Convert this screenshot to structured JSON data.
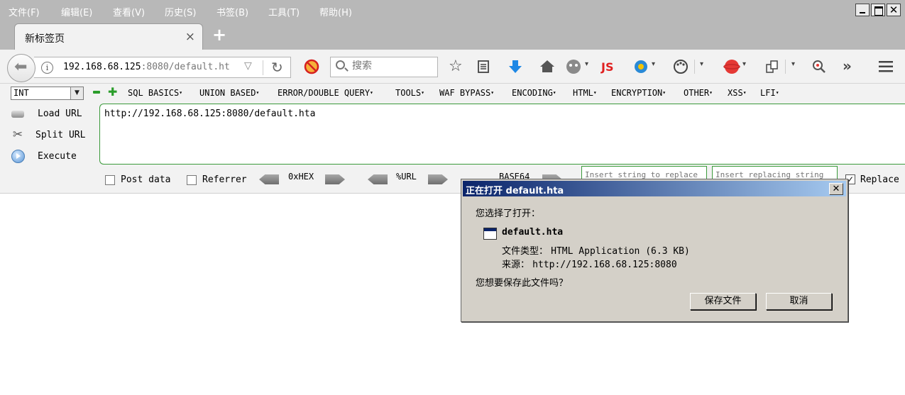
{
  "menubar": {
    "items": [
      "文件(F)",
      "编辑(E)",
      "查看(V)",
      "历史(S)",
      "书签(B)",
      "工具(T)",
      "帮助(H)"
    ]
  },
  "tabs": {
    "active_title": "新标签页",
    "close_glyph": "×",
    "new_tab_glyph": "+"
  },
  "navbar": {
    "url_host": "192.168.68.125",
    "url_rest": ":8080/default.ht",
    "search_placeholder": "搜索",
    "js_label": "JS"
  },
  "hackbar": {
    "int_value": "INT",
    "menus": [
      "SQL BASICS",
      "UNION BASED",
      "ERROR/DOUBLE QUERY",
      "TOOLS",
      "WAF BYPASS",
      "ENCODING",
      "HTML",
      "ENCRYPTION",
      "OTHER",
      "XSS",
      "LFI"
    ],
    "load_url": "Load URL",
    "split_url": "Split URL",
    "execute": "Execute",
    "url_value": "http://192.168.68.125:8080/default.hta",
    "post_data": "Post data",
    "referrer": "Referrer",
    "hex_label": "0xHEX",
    "url_label": "%URL",
    "base64_label": "BASE64",
    "insert_string_placeholder": "Insert string to replace",
    "insert_replacing_placeholder": "Insert replacing string",
    "replace_label": "Replace",
    "replace_checked": "✓"
  },
  "dialog": {
    "title": "正在打开 default.hta",
    "close_glyph": "✕",
    "chosen_text": "您选择了打开：",
    "file_name": "default.hta",
    "file_type_label": "文件类型：",
    "file_type_value": "HTML Application (6.3 KB)",
    "source_label": "来源：",
    "source_value": "http://192.168.68.125:8080",
    "question": "您想要保存此文件吗？",
    "save_button": "保存文件",
    "cancel_button": "取消"
  },
  "colors": {
    "chrome_gray": "#b8b8b8",
    "toolbar_bg": "#f2f2f2",
    "hackbar_green": "#3b9a3b",
    "dialog_bg": "#d4d0c8",
    "dialog_title_start": "#0a246a",
    "dialog_title_end": "#a6caf0",
    "download_blue": "#1e88e5",
    "js_red": "#e02020"
  }
}
